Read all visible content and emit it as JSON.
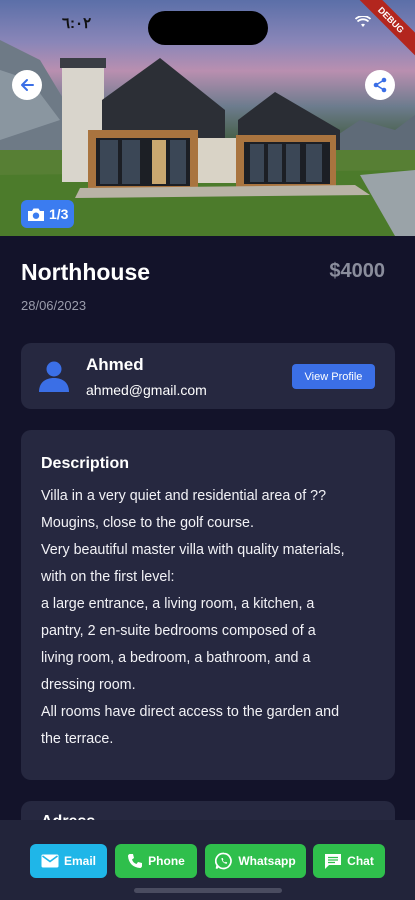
{
  "status_bar": {
    "time": "٦:٠٢",
    "debug_label": "DEBUG"
  },
  "hero": {
    "photo_counter": "1/3"
  },
  "listing": {
    "title": "Northhouse",
    "price": "$4000",
    "date": "28/06/2023"
  },
  "owner": {
    "name": "Ahmed",
    "email": "ahmed@gmail.com",
    "view_profile_label": "View Profile"
  },
  "description": {
    "heading": "Description",
    "lines": [
      "Villa in a very quiet and residential area of ??",
      "Mougins, close to the golf course.",
      "Very beautiful master villa with quality materials,",
      "with on the first level:",
      "a large entrance, a living room, a kitchen, a",
      "pantry, 2 en-suite bedrooms composed of a",
      "living room, a bedroom, a bathroom, and a",
      "dressing room.",
      "All rooms have direct access to the garden and",
      "the terrace."
    ]
  },
  "address": {
    "heading": "Adress"
  },
  "actions": {
    "email_label": "Email",
    "phone_label": "Phone",
    "whatsapp_label": "Whatsapp",
    "chat_label": "Chat"
  },
  "colors": {
    "background": "#13132a",
    "card": "#262840",
    "accent_blue": "#3b6fe6",
    "email_cyan": "#1fb6e8",
    "green": "#2fbf4c",
    "price_grey": "#8a8d9c"
  }
}
